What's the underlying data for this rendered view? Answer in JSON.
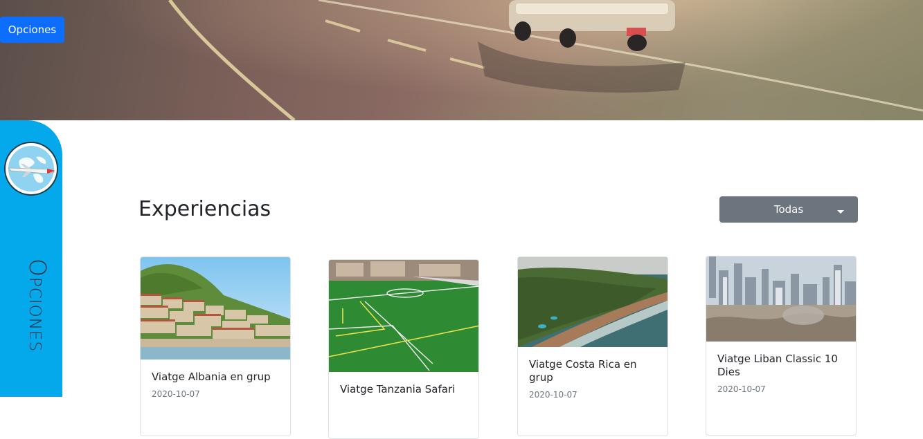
{
  "hero": {
    "options_button_label": "Opciones"
  },
  "side_panel": {
    "title": "Opciones"
  },
  "main": {
    "title": "Experiencias",
    "filter": {
      "selected": "Todas"
    }
  },
  "cards": [
    {
      "title": "Viatge Albania en grup",
      "date": "2020-10-07"
    },
    {
      "title": "Viatge Tanzania Safari",
      "date": ""
    },
    {
      "title": "Viatge Costa Rica en grup",
      "date": "2020-10-07"
    },
    {
      "title": "Viatge Liban Classic 10 Dies",
      "date": "2020-10-07"
    }
  ],
  "colors": {
    "primary": "#0d6efd",
    "side_panel": "#04a9ec",
    "filter_button": "#6c757d"
  }
}
